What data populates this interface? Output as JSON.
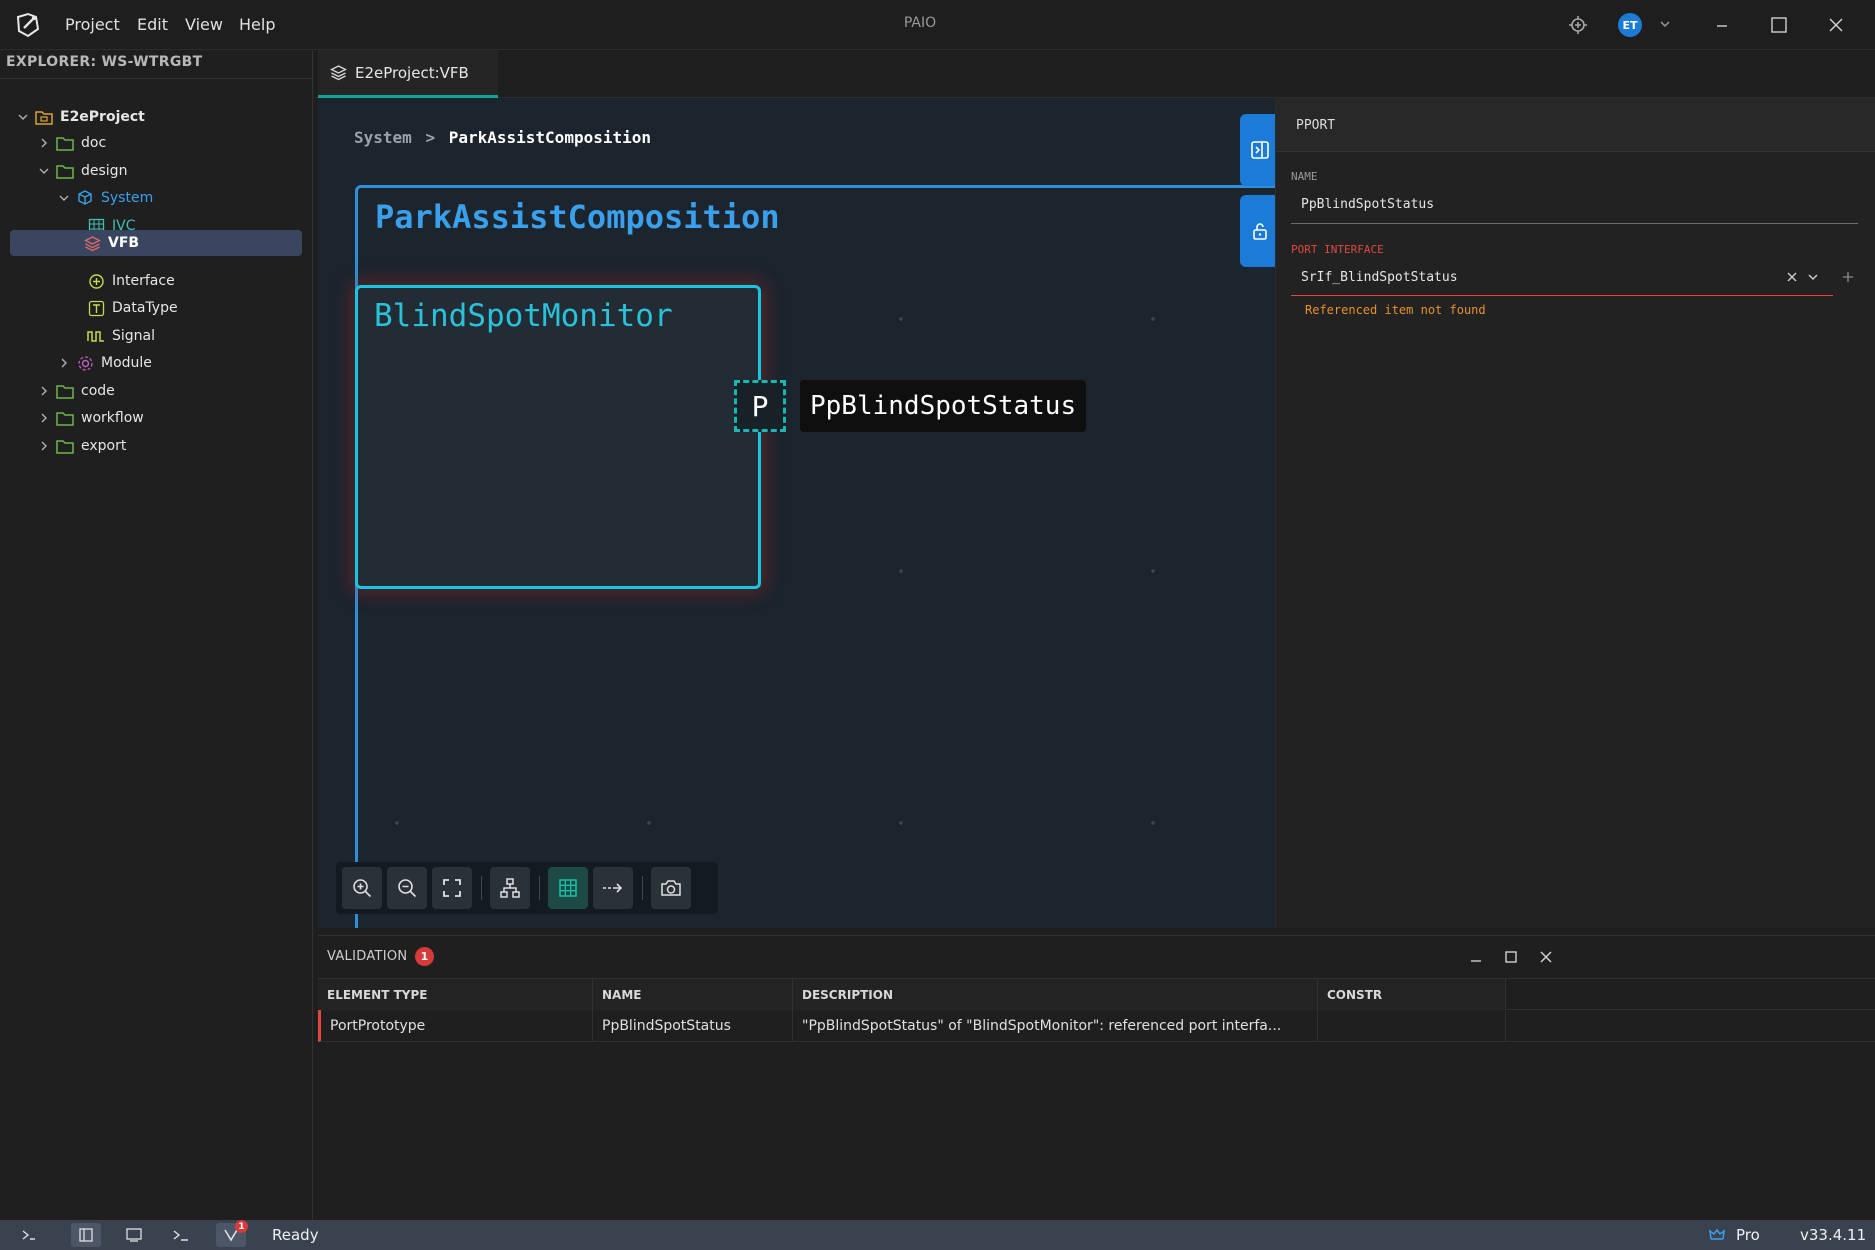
{
  "titlebar": {
    "menus": [
      "Project",
      "Edit",
      "View",
      "Help"
    ],
    "app_title": "PAIO",
    "avatar_initials": "ET"
  },
  "explorer": {
    "title": "EXPLORER: WS-WTRGBT",
    "tree": [
      {
        "label": "E2eProject",
        "icon": "project-folder-icon"
      },
      {
        "label": "doc",
        "icon": "folder-icon"
      },
      {
        "label": "design",
        "icon": "folder-icon"
      },
      {
        "label": "System",
        "icon": "cube-icon"
      },
      {
        "label": "IVC",
        "icon": "grid-icon"
      },
      {
        "label": "VFB",
        "icon": "layers-icon"
      },
      {
        "label": "Interface",
        "icon": "interface-icon"
      },
      {
        "label": "DataType",
        "icon": "datatype-icon"
      },
      {
        "label": "Signal",
        "icon": "signal-icon"
      },
      {
        "label": "Module",
        "icon": "module-icon"
      },
      {
        "label": "code",
        "icon": "folder-icon"
      },
      {
        "label": "workflow",
        "icon": "folder-icon"
      },
      {
        "label": "export",
        "icon": "folder-icon"
      }
    ]
  },
  "tabs": [
    {
      "label": "E2eProject:VFB",
      "active": true
    }
  ],
  "canvas": {
    "breadcrumb_parent": "System",
    "breadcrumb_separator": ">",
    "breadcrumb_current": "ParkAssistComposition",
    "composition_title": "ParkAssistComposition",
    "component_title": "BlindSpotMonitor",
    "port_letter": "P",
    "port_label": "PpBlindSpotStatus"
  },
  "properties": {
    "title": "PPORT",
    "name_label": "NAME",
    "name_value": "PpBlindSpotStatus",
    "interface_label": "PORT INTERFACE",
    "interface_value": "SrIf_BlindSpotStatus",
    "error_text": "Referenced item not found"
  },
  "validation": {
    "title": "VALIDATION",
    "count": "1",
    "columns": [
      "ELEMENT TYPE",
      "NAME",
      "DESCRIPTION",
      "CONSTR"
    ],
    "rows": [
      {
        "element_type": "PortPrototype",
        "name": "PpBlindSpotStatus",
        "description": "\"PpBlindSpotStatus\" of \"BlindSpotMonitor\": referenced port interfa...",
        "constr": ""
      }
    ]
  },
  "statusbar": {
    "validation_count": "1",
    "status": "Ready",
    "edition": "Pro",
    "version": "v33.4.11"
  },
  "colors": {
    "accent": "#14a39a",
    "composition_border": "#2c8fd8",
    "component_border": "#18c6df",
    "error": "#e0483e",
    "warning": "#e8902a",
    "selection": "#3a4660"
  }
}
